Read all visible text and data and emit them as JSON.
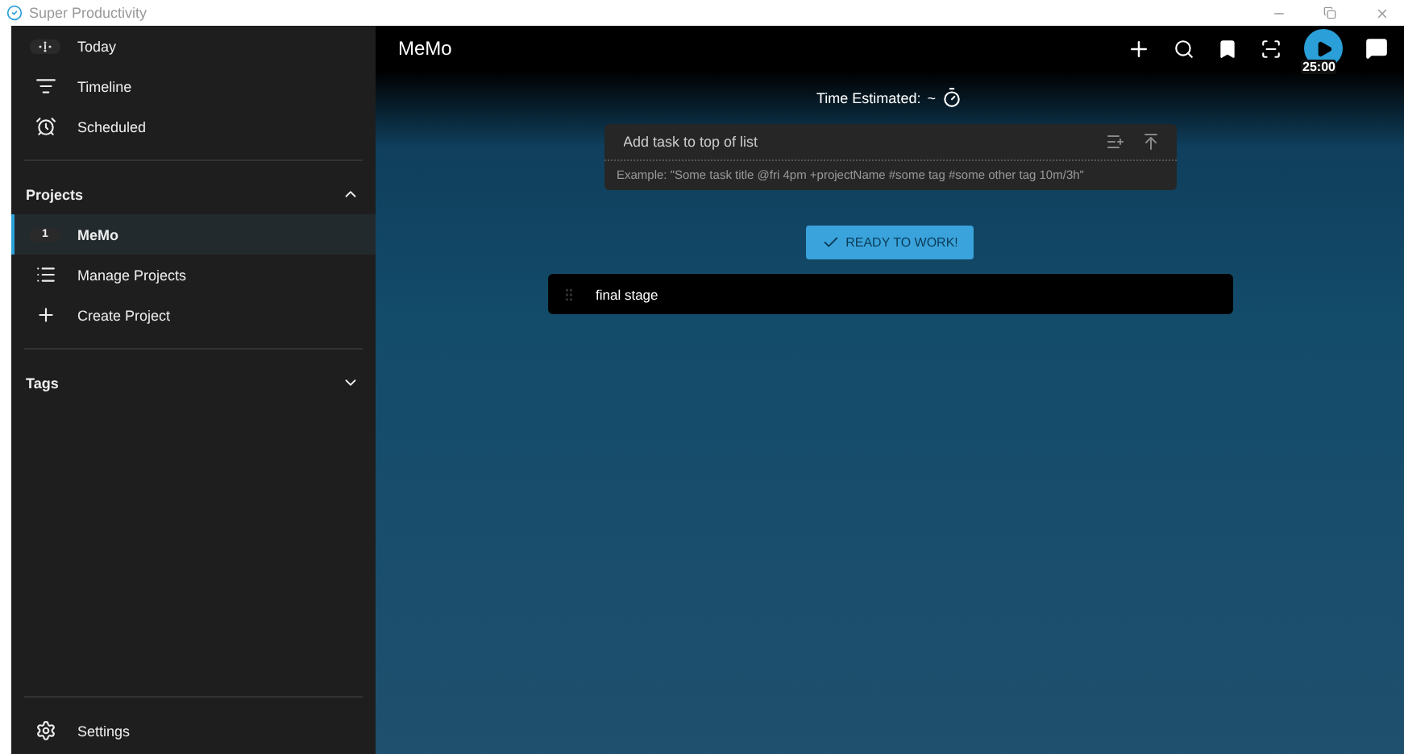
{
  "window": {
    "title": "Super Productivity"
  },
  "sidebar": {
    "items": [
      {
        "label": "Today",
        "kind": "today",
        "selected": false
      },
      {
        "label": "Timeline",
        "kind": "timeline",
        "selected": false
      },
      {
        "label": "Scheduled",
        "kind": "scheduled",
        "selected": false
      }
    ],
    "sections": [
      {
        "title": "Projects",
        "expanded": true,
        "items": [
          {
            "label": "MeMo",
            "badge": "1",
            "kind": "project",
            "selected": true
          },
          {
            "label": "Manage Projects",
            "kind": "manage",
            "selected": false
          },
          {
            "label": "Create Project",
            "kind": "create",
            "selected": false
          }
        ]
      },
      {
        "title": "Tags",
        "expanded": false
      }
    ],
    "settings": {
      "label": "Settings"
    }
  },
  "header": {
    "title": "MeMo",
    "timer": "25:00"
  },
  "time_estimated": {
    "label": "Time Estimated:",
    "value": "~"
  },
  "add_task": {
    "placeholder": "Add task to top of list",
    "hint": "Example: \"Some task title @fri 4pm +projectName #some tag #some other tag 10m/3h\""
  },
  "ready_button": {
    "label": "READY TO WORK!"
  },
  "tasks": [
    {
      "title": "final stage"
    }
  ]
}
